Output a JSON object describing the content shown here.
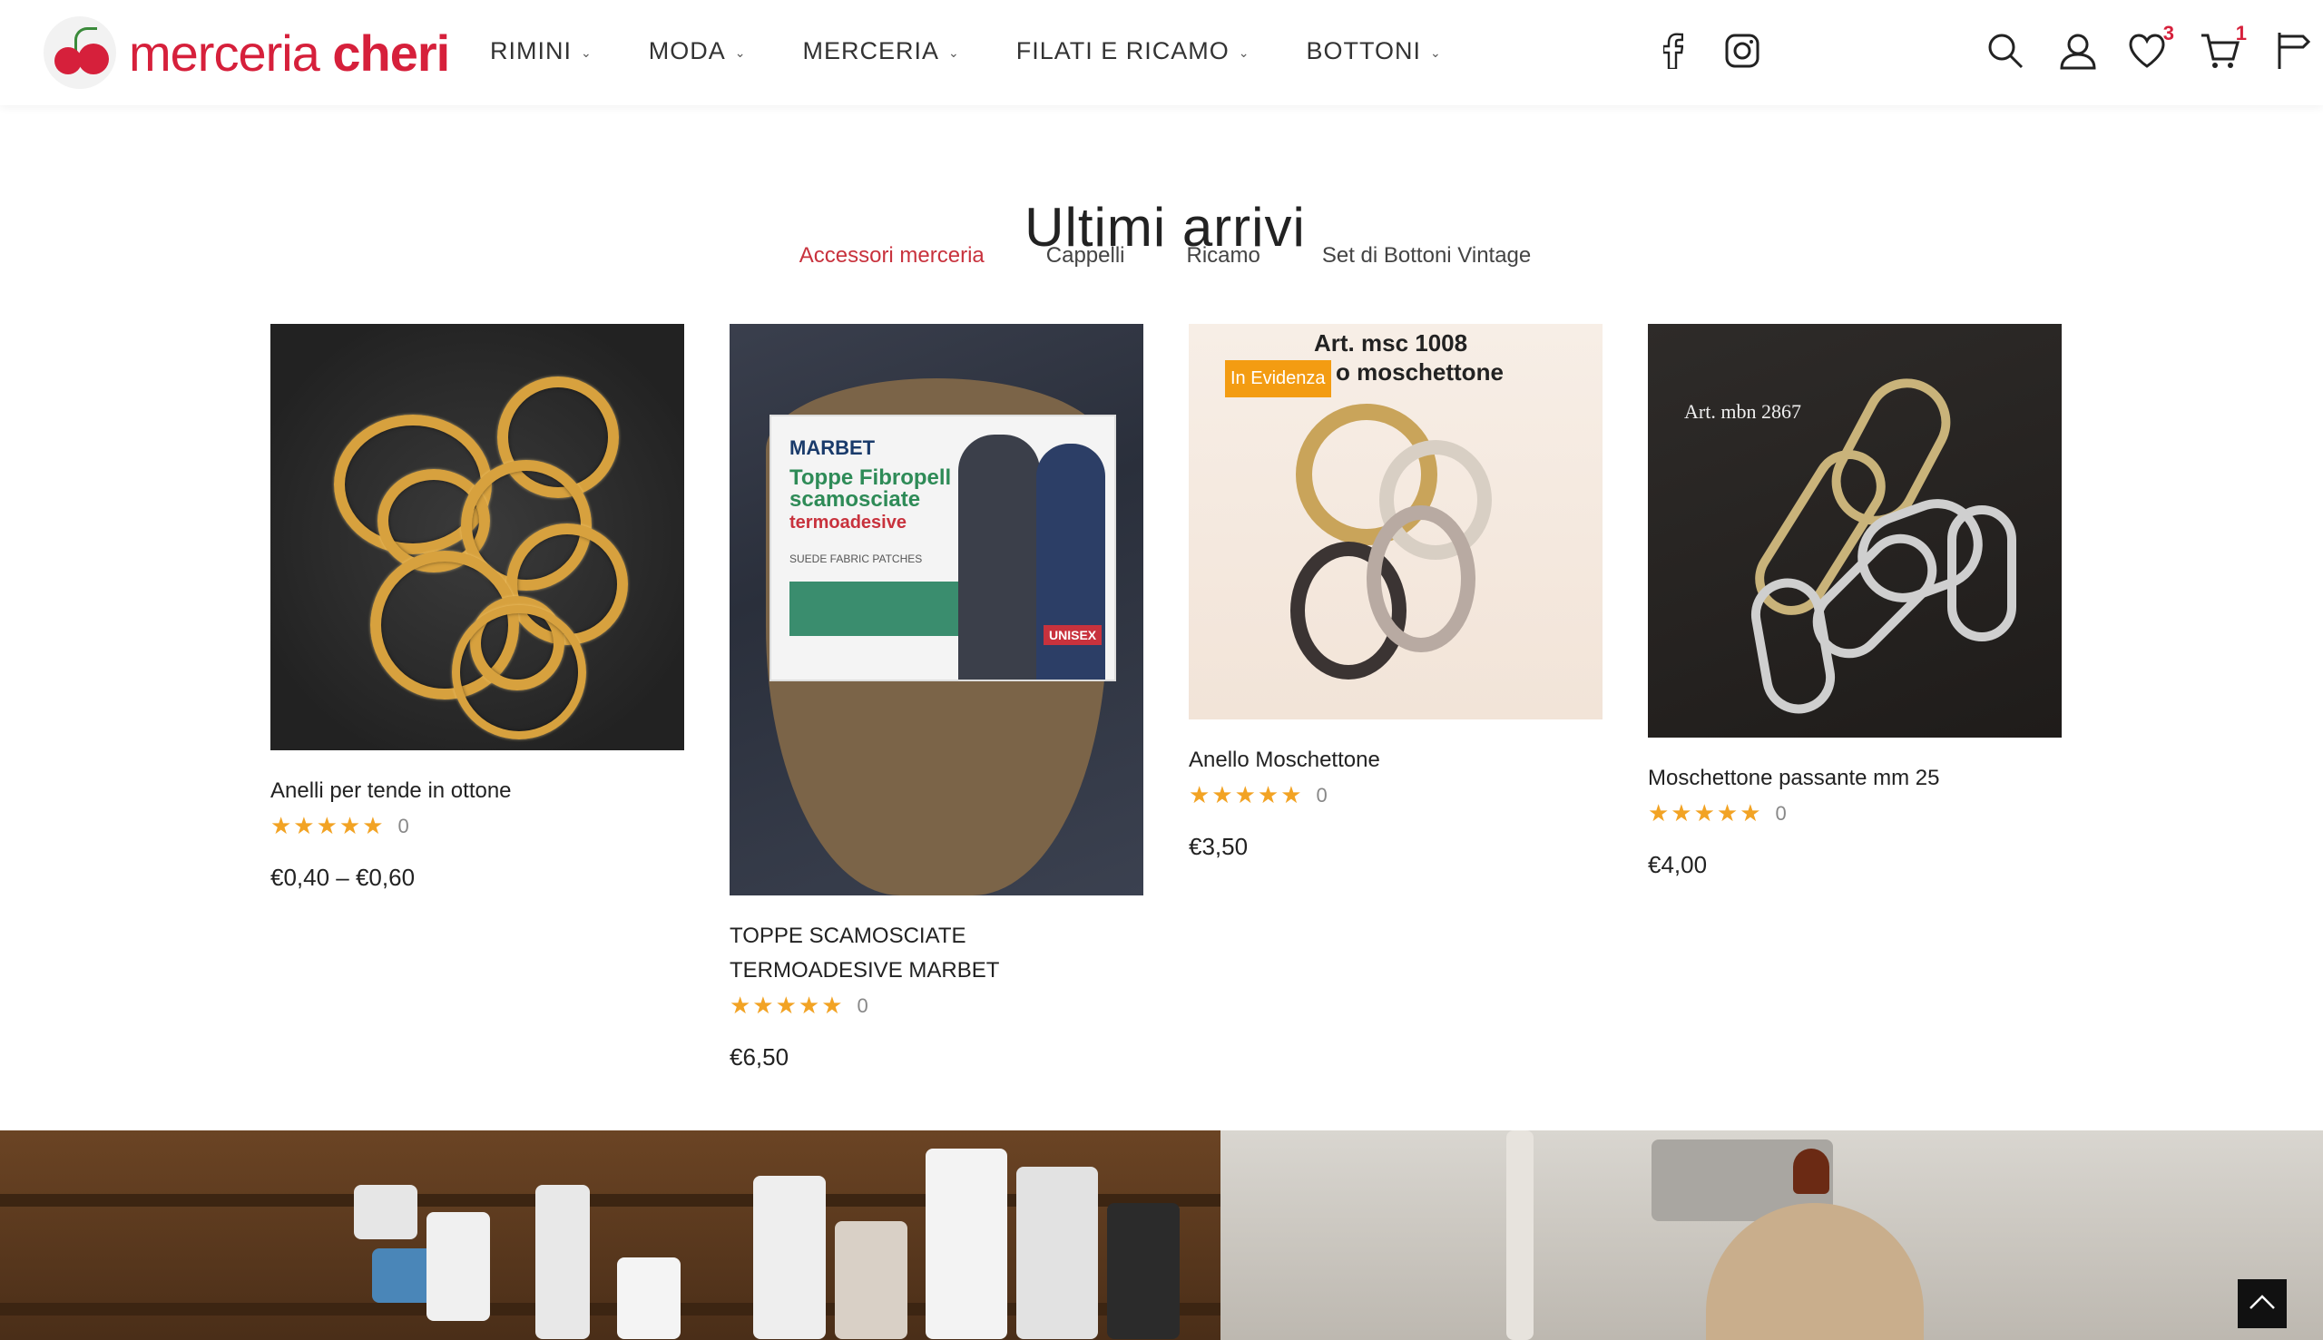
{
  "brand": {
    "name_light": "merceria",
    "name_bold": "cheri"
  },
  "nav": [
    {
      "label": "RIMINI"
    },
    {
      "label": "MODA"
    },
    {
      "label": "MERCERIA"
    },
    {
      "label": "FILATI E RICAMO"
    },
    {
      "label": "BOTTONI"
    }
  ],
  "header_icons": {
    "wishlist_count": "3",
    "cart_count": "1"
  },
  "section": {
    "title": "Ultimi arrivi",
    "tabs": [
      {
        "label": "Accessori merceria",
        "active": true
      },
      {
        "label": "Cappelli"
      },
      {
        "label": "Ricamo"
      },
      {
        "label": "Set di Bottoni Vintage"
      }
    ]
  },
  "products": [
    {
      "title": "Anelli per tende in ottone",
      "rating": "★★★★★",
      "reviews": "0",
      "price": "€0,40 – €0,60"
    },
    {
      "title": "TOPPE SCAMOSCIATE TERMOADESIVE MARBET",
      "rating": "★★★★★",
      "reviews": "0",
      "price": "€6,50",
      "image_text": {
        "brand": "MARBET",
        "headline": "Toppe Fibropell scamosciate",
        "subhead": "termoadesive",
        "sub": "SUEDE FABRIC PATCHES",
        "badge": "UNISEX"
      }
    },
    {
      "title": "Anello Moschettone",
      "rating": "★★★★★",
      "reviews": "0",
      "price": "€3,50",
      "badge": "In Evidenza",
      "image_text": {
        "line1": "Art. msc 1008",
        "line2": "o moschettone"
      }
    },
    {
      "title": "Moschettone passante mm 25",
      "rating": "★★★★★",
      "reviews": "0",
      "price": "€4,00",
      "image_text": {
        "line1": "Art. mbn 2867"
      }
    }
  ],
  "colors": {
    "accent": "#d6203b",
    "tab_active": "#c8323d",
    "star": "#f2a324",
    "badge": "#f39c12"
  }
}
